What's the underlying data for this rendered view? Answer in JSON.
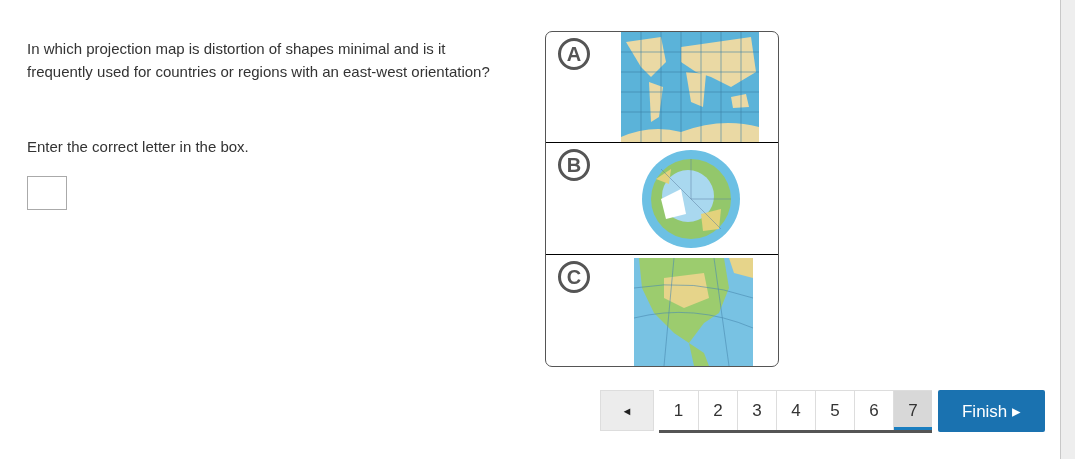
{
  "question": "In which projection map is distortion of shapes minimal and is it frequently used for countries or regions with an east-west orientation?",
  "instruction": "Enter the correct letter in the box.",
  "options": [
    {
      "letter": "A",
      "kind": "picture"
    },
    {
      "letter": "B",
      "kind": "picture"
    },
    {
      "letter": "C",
      "kind": "picture"
    }
  ],
  "pager": {
    "prev": "◄",
    "pages": [
      {
        "label": "1",
        "selected": false
      },
      {
        "label": "2",
        "selected": false
      },
      {
        "label": "3",
        "selected": false
      },
      {
        "label": "4",
        "selected": false
      },
      {
        "label": "5",
        "selected": false
      },
      {
        "label": "6",
        "selected": false
      },
      {
        "label": "7",
        "selected": true
      }
    ],
    "finish": "Finish ▸"
  }
}
